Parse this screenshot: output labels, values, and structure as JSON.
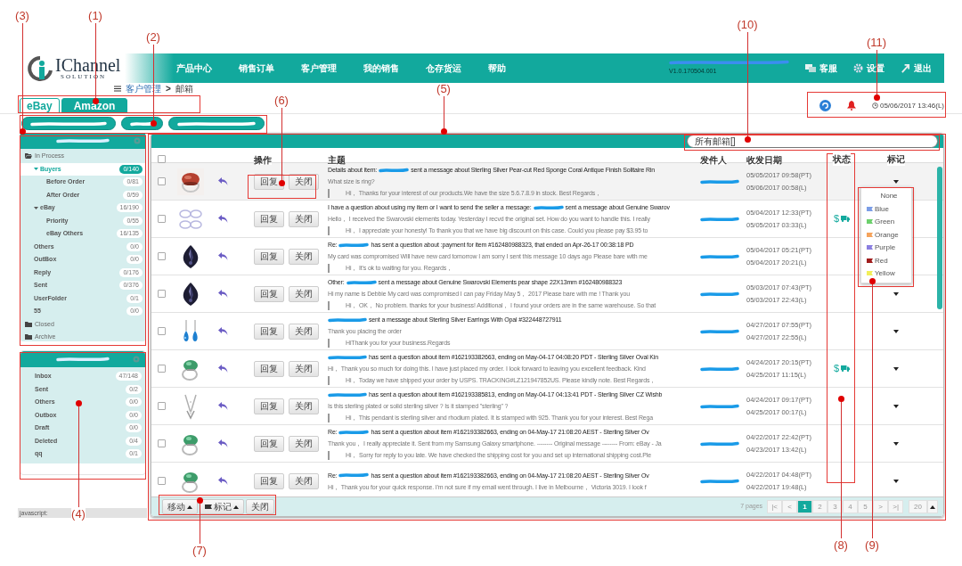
{
  "logo": {
    "name": "IChannel",
    "tagline": "SOLUTION"
  },
  "nav": {
    "items": [
      "产品中心",
      "销售订单",
      "客户管理",
      "我的销售",
      "仓存货运",
      "帮助"
    ],
    "version": "V1.0.170504.001",
    "actions": [
      {
        "kind": "chat",
        "label": "客服"
      },
      {
        "kind": "settings",
        "label": "设置"
      },
      {
        "kind": "logout",
        "label": "退出"
      }
    ]
  },
  "breadcrumb": {
    "parent": "客户管理",
    "separator": ">",
    "current": "邮箱"
  },
  "platform_tabs": [
    {
      "label": "eBay",
      "selected": true
    },
    {
      "label": "Amazon",
      "selected": false
    }
  ],
  "clock": "05/06/2017 13:46(L)",
  "account_buttons": [
    {
      "selected": false
    },
    {
      "selected": false
    },
    {
      "selected": false
    }
  ],
  "mail_folders": [
    {
      "label": "In Process",
      "expanded": true,
      "selected": false,
      "children": [
        {
          "label": "Buyers",
          "count": "0/140",
          "expanded": true,
          "selected": true,
          "children": [
            {
              "label": "Before Order",
              "count": "0/81",
              "selected": false
            },
            {
              "label": "After Order",
              "count": "0/59",
              "selected": false
            }
          ]
        },
        {
          "label": "eBay",
          "count": "16/190",
          "expanded": true,
          "selected": false,
          "children": [
            {
              "label": "Priority",
              "count": "0/55",
              "selected": false
            },
            {
              "label": "eBay Others",
              "count": "16/135",
              "selected": false
            }
          ]
        },
        {
          "label": "Others",
          "count": "0/0",
          "selected": false
        },
        {
          "label": "OutBox",
          "count": "0/0",
          "selected": false
        },
        {
          "label": "Reply",
          "count": "0/176",
          "selected": false
        },
        {
          "label": "Sent",
          "count": "0/376",
          "selected": false
        },
        {
          "label": "UserFolder",
          "count": "0/1",
          "selected": false
        },
        {
          "label": "55",
          "count": "0/0",
          "selected": false
        }
      ]
    },
    {
      "label": "Closed",
      "expanded": false,
      "selected": false
    },
    {
      "label": "Archive",
      "expanded": false,
      "selected": false
    }
  ],
  "account_folders": [
    {
      "label": "Inbox",
      "count": "47/148",
      "selected": false
    },
    {
      "label": "Sent",
      "count": "0/2",
      "selected": false
    },
    {
      "label": "Others",
      "count": "0/0",
      "selected": false
    },
    {
      "label": "Outbox",
      "count": "0/0",
      "selected": false
    },
    {
      "label": "Draft",
      "count": "0/0",
      "selected": false
    },
    {
      "label": "Deleted",
      "count": "0/4",
      "selected": false
    },
    {
      "label": "qq",
      "count": "0/1",
      "selected": false
    }
  ],
  "search": {
    "value": "所有邮箱[]"
  },
  "table": {
    "select_all": {
      "checked": false
    },
    "columns": [
      "操作",
      "主题",
      "发件人",
      "收发日期",
      "状态",
      "标记"
    ],
    "rows": [
      {
        "checked": false,
        "selected": true,
        "thumbnail": {
          "kind": "picture"
        },
        "actions": [
          "回复",
          "关闭"
        ],
        "subject_before": "Details about item:",
        "subject_after": "sent a message about Sterling Silver Pear-cut Red Sponge Coral Antique Finish Solitaire Rin",
        "preview": "What size is ring?",
        "reply": "Hi， Thanks for your interest of our products.We have the size 5.6.7.8.9 in stock. Best Regards，",
        "date_pt": "05/05/2017 09:58(PT)",
        "date_l": "05/06/2017 00:58(L)"
      },
      {
        "checked": false,
        "selected": false,
        "thumbnail": {
          "kind": "picture"
        },
        "actions": [
          "回复",
          "关闭"
        ],
        "subject_before": "I have a question about using my item or I want to send the seller a message:",
        "subject_after": "sent a message about Genuine Swarov",
        "preview": "Hello， I received the Swarovski elements today. Yesterday I recvd the original set. How do you want to handle this. I really",
        "reply": "Hi， I appreciate your honesty! To thank you that we have big discount on this case. Could you please pay $3.95 to",
        "date_pt": "05/04/2017 12:33(PT)",
        "date_l": "05/05/2017 03:33(L)",
        "status": {
          "symbol": "$",
          "shipped": true
        }
      },
      {
        "checked": false,
        "selected": false,
        "thumbnail": {
          "kind": "picture"
        },
        "actions": [
          "回复",
          "关闭"
        ],
        "subject_before": "Re:",
        "subject_after": "has sent a question about :payment for item #162480988323, that ended on Apr-26-17 00:38:18 PD",
        "preview": "My card was compromised Will have new card tomorrow I am sorry I sent this message 10 days ago Please bare with me",
        "reply": "Hi， It's ok to waiting for you. Regards，",
        "date_pt": "05/04/2017 05:21(PT)",
        "date_l": "05/04/2017 20:21(L)"
      },
      {
        "checked": false,
        "selected": false,
        "thumbnail": {
          "kind": "picture"
        },
        "actions": [
          "回复",
          "关闭"
        ],
        "subject_before": "Other:",
        "subject_after": "sent a message about Genuine Swarovski Elements pear shape 22X13mm #162480988323",
        "preview": "Hi my name is Debbie My card was compromised I can pay Friday May 5， 2017 Please bare with me ! Thank you",
        "reply": "Hi， OK， No problem. thanks for your business! Additional， I found your orders are in the same warehouse. So that",
        "date_pt": "05/03/2017 07:43(PT)",
        "date_l": "05/03/2017 22:43(L)"
      },
      {
        "checked": false,
        "selected": false,
        "thumbnail": {
          "kind": "picture"
        },
        "actions": [
          "回复",
          "关闭"
        ],
        "subject_after": "sent a message about Sterling Silver Earrings With Opal #322448727911",
        "preview": "Thank you placing the order",
        "reply": "HiThank you for your business.Regards",
        "date_pt": "04/27/2017 07:55(PT)",
        "date_l": "04/27/2017 22:55(L)"
      },
      {
        "checked": false,
        "selected": false,
        "thumbnail": {
          "kind": "picture"
        },
        "actions": [
          "回复",
          "关闭"
        ],
        "subject_after": "has sent a question about item #162193382663, ending on May-04-17 04:08:20 PDT - Sterling Silver Oval Kin",
        "preview": "Hi， Thank you so much for doing this. I have just placed my order. I look forward to leaving you excellent feedback. Kind",
        "reply": "Hi， Today we have shipped your order by USPS. TRACKING#LZ121947852US. Please kindly note. Best Regards，",
        "date_pt": "04/24/2017 20:15(PT)",
        "date_l": "04/25/2017 11:15(L)",
        "status": {
          "symbol": "$",
          "shipped": true
        }
      },
      {
        "checked": false,
        "selected": false,
        "thumbnail": {
          "kind": "picture"
        },
        "actions": [
          "回复",
          "关闭"
        ],
        "subject_after": "has sent a question about item #162193385813, ending on May-04-17 04:13:41 PDT - Sterling Silver CZ Wishb",
        "preview": "Is this sterling plated or solid sterling silver ? Is it stamped \"sterling\" ?",
        "reply": "Hi， This pendant is sterling silver and rhodium plated. It is stamped with 925. Thank you for your interest. Best Rega",
        "date_pt": "04/24/2017 09:17(PT)",
        "date_l": "04/25/2017 00:17(L)"
      },
      {
        "checked": false,
        "selected": false,
        "thumbnail": {
          "kind": "picture"
        },
        "actions": [
          "回复",
          "关闭"
        ],
        "subject_before": "Re:",
        "subject_after": "has sent a question about item #162193382663, ending on 04-May-17 21:08:20 AEST - Sterling Silver Ov",
        "preview": "Thank you， I really appreciate it. Sent from my Samsung Galaxy smartphone. -------- Original message -------- From: eBay - Ja",
        "reply": "Hi， Sorry for reply to you late. We have checked the shipping cost for you and set up international shipping cost.Ple",
        "date_pt": "04/22/2017 22:42(PT)",
        "date_l": "04/23/2017 13:42(L)"
      },
      {
        "checked": false,
        "selected": false,
        "thumbnail": {
          "kind": "picture"
        },
        "actions": [
          "回复",
          "关闭"
        ],
        "subject_before": "Re:",
        "subject_after": "has sent a question about item #162193382663, ending on 04-May-17 21:08:20 AEST - Sterling Silver Ov",
        "preview": "Hi， Thank you for your quick response. I'm not sure if my email went through. I live in Melbourne， Victoria 3019. I look f",
        "date_pt": "04/22/2017 04:48(PT)",
        "date_l": "04/22/2017 19:48(L)"
      }
    ]
  },
  "flag_menu": {
    "items": [
      {
        "label": "None"
      },
      {
        "label": "Blue",
        "color": "#7b9de6"
      },
      {
        "label": "Green",
        "color": "#6cd06c"
      },
      {
        "label": "Orange",
        "color": "#f5a35c"
      },
      {
        "label": "Purple",
        "color": "#8a7ee0"
      },
      {
        "label": "Red",
        "color": "#a01c1c"
      },
      {
        "label": "Yellow",
        "color": "#f2ef5a"
      }
    ]
  },
  "footer": {
    "buttons": [
      {
        "kind": "move",
        "label": "移动"
      },
      {
        "kind": "flag",
        "label": "标记"
      },
      {
        "kind": "close",
        "label": "关闭"
      }
    ],
    "pages_label": "7 pages",
    "pager": [
      {
        "label": "|<",
        "selected": false
      },
      {
        "label": "<",
        "selected": false
      },
      {
        "label": "1",
        "selected": true
      },
      {
        "label": "2",
        "selected": false
      },
      {
        "label": "3",
        "selected": false
      },
      {
        "label": "4",
        "selected": false
      },
      {
        "label": "5",
        "selected": false
      },
      {
        "label": ">",
        "selected": false
      },
      {
        "label": ">|",
        "selected": false
      }
    ],
    "page_size": "20"
  },
  "status_bar": "javascript:",
  "annotations": [
    {
      "label": "(1)"
    },
    {
      "label": "(2)"
    },
    {
      "label": "(3)"
    },
    {
      "label": "(4)"
    },
    {
      "label": "(5)"
    },
    {
      "label": "(6)"
    },
    {
      "label": "(7)"
    },
    {
      "label": "(8)"
    },
    {
      "label": "(9)"
    },
    {
      "label": "(10)"
    },
    {
      "label": "(11)"
    }
  ]
}
